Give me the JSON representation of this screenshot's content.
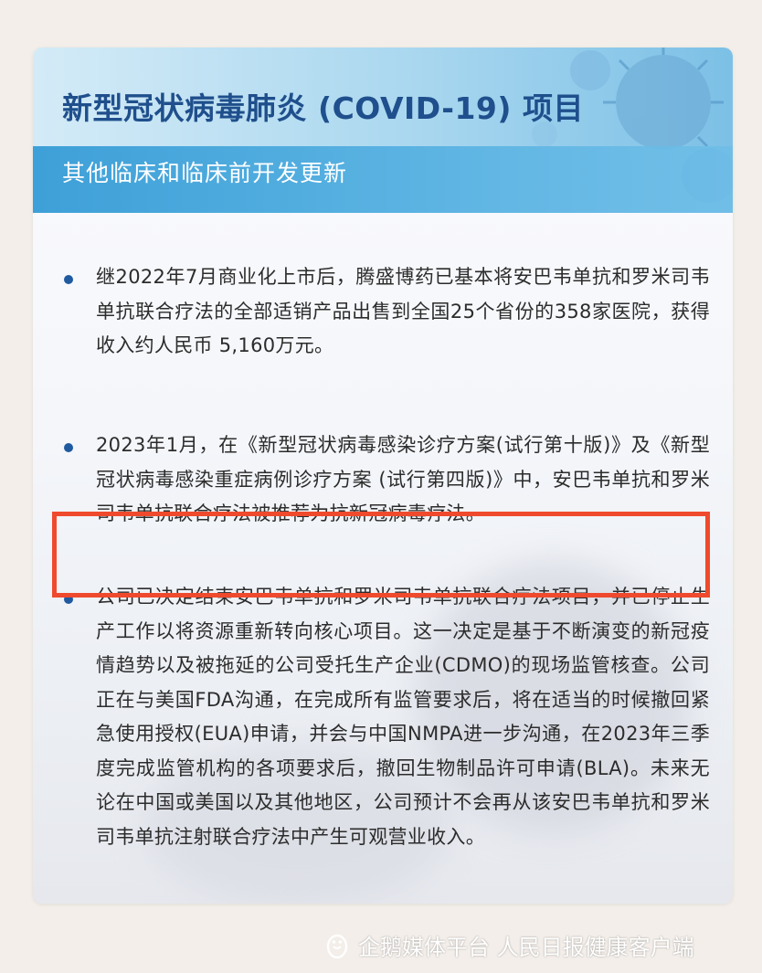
{
  "header": {
    "title": "新型冠状病毒肺炎 (COVID-19) 项目",
    "subtitle": "其他临床和临床前开发更新"
  },
  "items": [
    {
      "text": "继2022年7月商业化上市后，腾盛博药已基本将安巴韦单抗和罗米司韦单抗联合疗法的全部适销产品出售到全国25个省份的358家医院，获得收入约人民币 5,160万元。"
    },
    {
      "text": "2023年1月，在《新型冠状病毒感染诊疗方案(试行第十版)》及《新型冠状病毒感染重症病例诊疗方案 (试行第四版)》中，安巴韦单抗和罗米司韦单抗联合疗法被推荐为抗新冠病毒疗法。"
    },
    {
      "text": "公司已决定结束安巴韦单抗和罗米司韦单抗联合疗法项目，并已停止生产工作以将资源重新转向核心项目。这一决定是基于不断演变的新冠疫情趋势以及被拖延的公司受托生产企业(CDMO)的现场监管核查。公司正在与美国FDA沟通，在完成所有监管要求后，将在适当的时候撤回紧急使用授权(EUA)申请，并会与中国NMPA进一步沟通，在2023年三季度完成监管机构的各项要求后，撤回生物制品许可申请(BLA)。未来无论在中国或美国以及其他地区，公司预计不会再从该安巴韦单抗和罗米司韦单抗注射联合疗法中产生可观营业收入。"
    }
  ],
  "watermark": {
    "logo_icon": "penguin-icon",
    "text": "企鹅媒体平台 人民日报健康客户端"
  },
  "colors": {
    "title": "#1f4f8c",
    "subtitle_bar": "#3ea0d8",
    "bullet": "#1f5aa0",
    "highlight": "#ef4a2d"
  }
}
